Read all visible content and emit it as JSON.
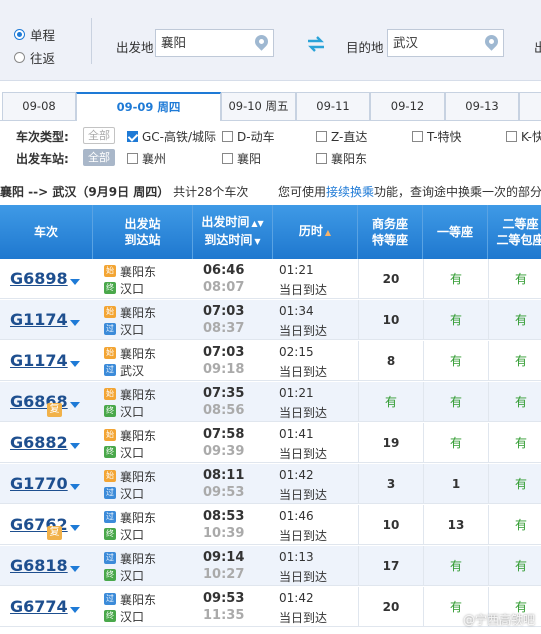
{
  "search": {
    "trip_types": [
      {
        "label": "单程",
        "selected": true
      },
      {
        "label": "往返",
        "selected": false
      }
    ],
    "from_label": "出发地",
    "from_value": "襄阳",
    "to_label": "目的地",
    "to_value": "武汉",
    "cut_label": "出"
  },
  "date_tabs": [
    {
      "label": "09-08",
      "active": false
    },
    {
      "label": "09-09 周四",
      "active": true
    },
    {
      "label": "09-10 周五",
      "active": false
    },
    {
      "label": "09-11",
      "active": false
    },
    {
      "label": "09-12",
      "active": false
    },
    {
      "label": "09-13",
      "active": false
    }
  ],
  "filters": {
    "type_label": "车次类型:",
    "type_all": "全部",
    "types": [
      {
        "label": "GC-高铁/城际",
        "checked": true
      },
      {
        "label": "D-动车",
        "checked": false
      },
      {
        "label": "Z-直达",
        "checked": false
      },
      {
        "label": "T-特快",
        "checked": false
      },
      {
        "label": "K-快",
        "checked": false
      }
    ],
    "station_label": "出发车站:",
    "station_all": "全部",
    "stations": [
      {
        "label": "襄州",
        "checked": false
      },
      {
        "label": "襄阳",
        "checked": false
      },
      {
        "label": "襄阳东",
        "checked": false
      }
    ]
  },
  "summary": {
    "route": "襄阳 --> 武汉（9月9日  周四）",
    "count": "共计28个车次",
    "hint_pre": "您可使用",
    "hint_link": "接续换乘",
    "hint_post": "功能，查询途中换乘一次的部分"
  },
  "table": {
    "headers": {
      "train": "车次",
      "station_1": "出发站",
      "station_2": "到达站",
      "time_1": "出发时间",
      "time_2": "到达时间",
      "duration": "历时",
      "business_1": "商务座",
      "business_2": "特等座",
      "first": "一等座",
      "second_1": "二等座",
      "second_2": "二等包座"
    },
    "rows": [
      {
        "train": "G6898",
        "fu": "",
        "from": "襄阳东",
        "from_badge": "始",
        "to": "汉口",
        "to_badge": "终",
        "dep": "06:46",
        "arr": "08:07",
        "dur": "01:21",
        "note": "当日到达",
        "business": "20",
        "first": "有",
        "second": "有"
      },
      {
        "train": "G1174",
        "fu": "",
        "from": "襄阳东",
        "from_badge": "始",
        "to": "汉口",
        "to_badge": "过",
        "dep": "07:03",
        "arr": "08:37",
        "dur": "01:34",
        "note": "当日到达",
        "business": "10",
        "first": "有",
        "second": "有"
      },
      {
        "train": "G1174",
        "fu": "",
        "from": "襄阳东",
        "from_badge": "始",
        "to": "武汉",
        "to_badge": "过",
        "dep": "07:03",
        "arr": "09:18",
        "dur": "02:15",
        "note": "当日到达",
        "business": "8",
        "first": "有",
        "second": "有"
      },
      {
        "train": "G6868",
        "fu": "复",
        "from": "襄阳东",
        "from_badge": "始",
        "to": "汉口",
        "to_badge": "终",
        "dep": "07:35",
        "arr": "08:56",
        "dur": "01:21",
        "note": "当日到达",
        "business": "有",
        "first": "有",
        "second": "有"
      },
      {
        "train": "G6882",
        "fu": "",
        "from": "襄阳东",
        "from_badge": "始",
        "to": "汉口",
        "to_badge": "终",
        "dep": "07:58",
        "arr": "09:39",
        "dur": "01:41",
        "note": "当日到达",
        "business": "19",
        "first": "有",
        "second": "有"
      },
      {
        "train": "G1770",
        "fu": "",
        "from": "襄阳东",
        "from_badge": "始",
        "to": "汉口",
        "to_badge": "过",
        "dep": "08:11",
        "arr": "09:53",
        "dur": "01:42",
        "note": "当日到达",
        "business": "3",
        "first": "1",
        "second": "有"
      },
      {
        "train": "G6762",
        "fu": "复",
        "from": "襄阳东",
        "from_badge": "过",
        "to": "汉口",
        "to_badge": "终",
        "dep": "08:53",
        "arr": "10:39",
        "dur": "01:46",
        "note": "当日到达",
        "business": "10",
        "first": "13",
        "second": "有"
      },
      {
        "train": "G6818",
        "fu": "",
        "from": "襄阳东",
        "from_badge": "过",
        "to": "汉口",
        "to_badge": "终",
        "dep": "09:14",
        "arr": "10:27",
        "dur": "01:13",
        "note": "当日到达",
        "business": "17",
        "first": "有",
        "second": "有"
      },
      {
        "train": "G6774",
        "fu": "",
        "from": "襄阳东",
        "from_badge": "过",
        "to": "汉口",
        "to_badge": "终",
        "dep": "09:53",
        "arr": "11:35",
        "dur": "01:42",
        "note": "当日到达",
        "business": "20",
        "first": "有",
        "second": "有"
      }
    ]
  },
  "watermark": "@宁西高铁吧",
  "colors": {
    "accent": "#1e7ad6",
    "header_bg": "#2a84d8",
    "available": "#2e9a2e",
    "start_badge": "#f3a534",
    "pass_badge": "#3c8bd9",
    "end_badge": "#4aa84b"
  }
}
